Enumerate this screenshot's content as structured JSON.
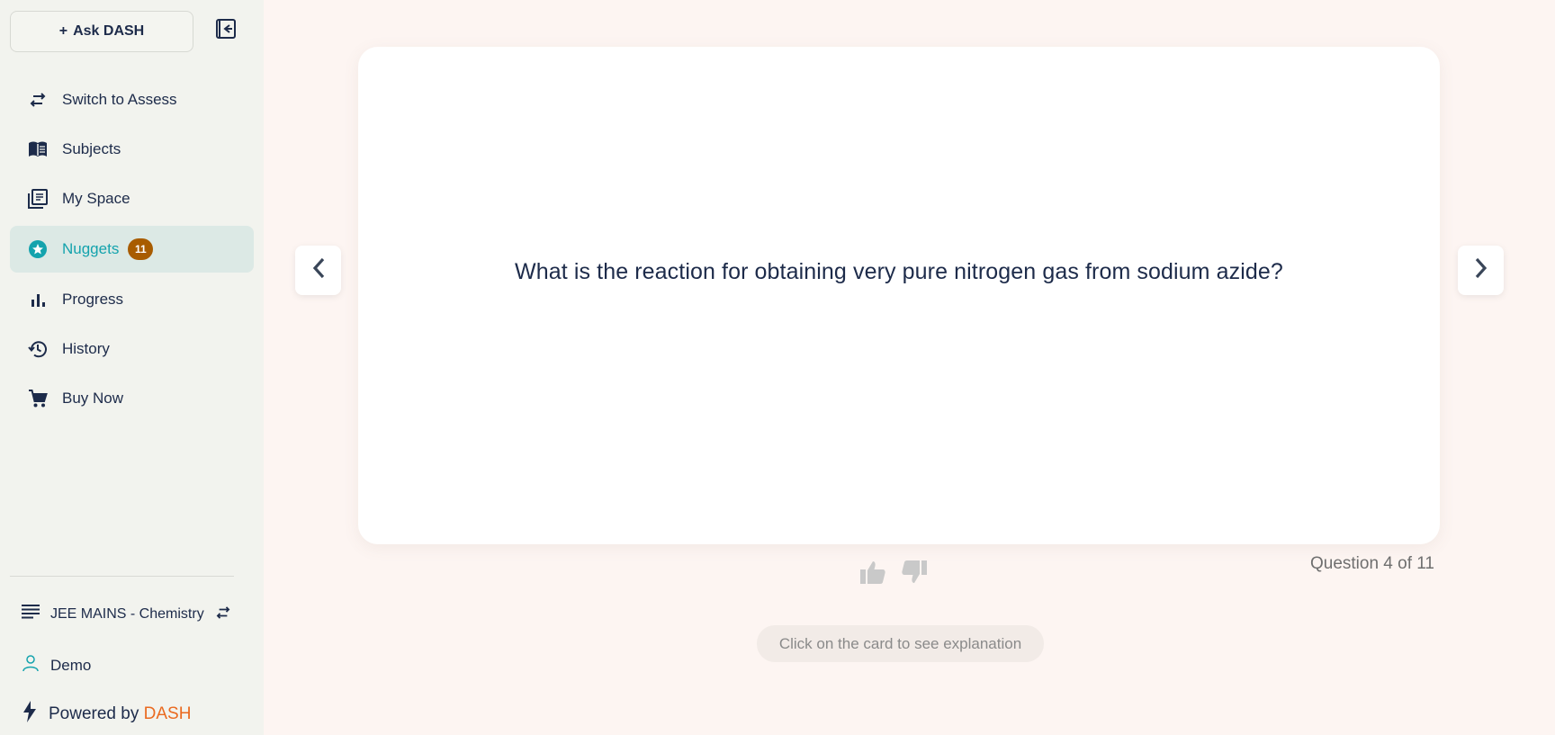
{
  "sidebar": {
    "ask_button": {
      "plus": "+",
      "label": "Ask DASH"
    },
    "collapse_icon": "sidebar-collapse-icon",
    "items": [
      {
        "label": "Switch to Assess",
        "icon": "swap-arrows-icon"
      },
      {
        "label": "Subjects",
        "icon": "book-open-icon"
      },
      {
        "label": "My Space",
        "icon": "library-icon"
      },
      {
        "label": "Nuggets",
        "icon": "star-circle-icon",
        "badge": "11",
        "active": true
      },
      {
        "label": "Progress",
        "icon": "bar-chart-icon"
      },
      {
        "label": "History",
        "icon": "history-icon"
      },
      {
        "label": "Buy Now",
        "icon": "cart-icon"
      }
    ],
    "course": {
      "label": "JEE MAINS - Chemistry"
    },
    "user": {
      "name": "Demo"
    },
    "powered": {
      "prefix": "Powered by",
      "brand": "DASH"
    }
  },
  "main": {
    "question_text": "What is the reaction for obtaining very pure nitrogen gas from sodium azide?",
    "counter": "Question 4 of 11",
    "hint": "Click on the card to see explanation"
  },
  "colors": {
    "accent": "#14a3ad",
    "badge": "#a85c00",
    "brand": "#ea6a20"
  }
}
